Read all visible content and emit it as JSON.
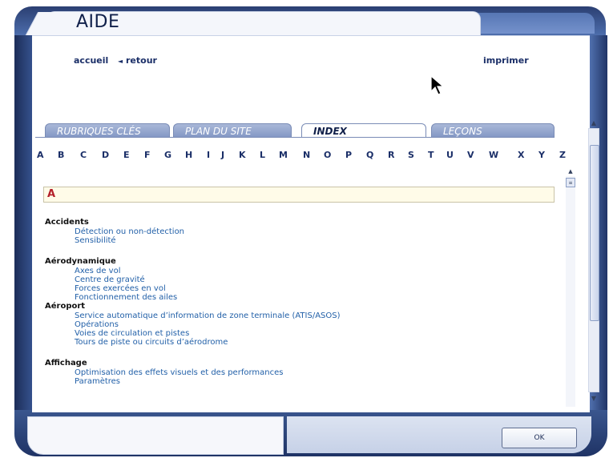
{
  "window": {
    "title": "AIDE"
  },
  "top_links": {
    "home": "accueil",
    "back": "retour",
    "back_arrow": "◄",
    "print": "imprimer"
  },
  "tabs": [
    {
      "label": "RUBRIQUES CLÉS",
      "active": false
    },
    {
      "label": "PLAN DU SITE",
      "active": false
    },
    {
      "label": "INDEX",
      "active": true
    },
    {
      "label": "LEÇONS",
      "active": false
    }
  ],
  "alphabet": [
    "A",
    "B",
    "C",
    "D",
    "E",
    "F",
    "G",
    "H",
    "I",
    "J",
    "K",
    "L",
    "M",
    "N",
    "O",
    "P",
    "Q",
    "R",
    "S",
    "T",
    "U",
    "V",
    "W",
    "X",
    "Y",
    "Z"
  ],
  "letter_heading": "A",
  "index": [
    {
      "title": "Accidents",
      "items": [
        "Détection ou non-détection",
        "Sensibilité"
      ]
    },
    {
      "title": "Aérodynamique",
      "items": [
        "Axes de vol",
        "Centre de gravité",
        "Forces exercées en vol",
        "Fonctionnement des ailes"
      ]
    },
    {
      "title": "Aéroport",
      "items": [
        "Service automatique d’information de zone terminale (ATIS/ASOS)",
        "Opérations",
        "Voies de circulation et pistes",
        "Tours de piste ou circuits d’aérodrome"
      ]
    },
    {
      "title": "Affichage",
      "items": [
        "Optimisation des effets visuels et des performances",
        "Paramètres"
      ]
    }
  ],
  "buttons": {
    "ok": "OK"
  },
  "colors": {
    "link": "#1b2f68",
    "entry": "#2260a8",
    "letter_heading": "#b3202a",
    "frame": "#2b3f72"
  }
}
